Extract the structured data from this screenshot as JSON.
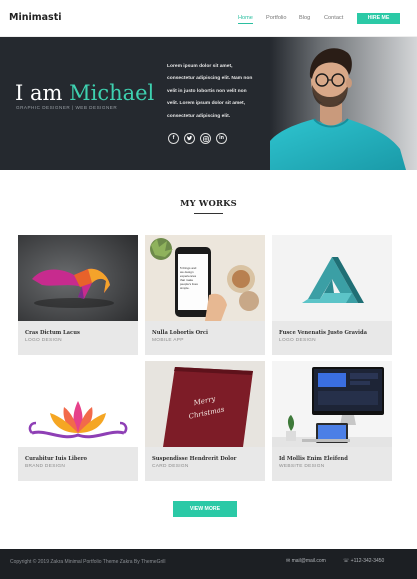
{
  "navbar": {
    "brand": "Minimasti",
    "links": [
      "Home",
      "Portfolio",
      "Blog",
      "Contact"
    ],
    "active_link": "Home",
    "hire_label": "HIRE ME"
  },
  "hero": {
    "greeting": "I am",
    "name": "Michael",
    "subtitle": "GRAPHIC DESIGNER | WEB DESIGNER",
    "text_lines": [
      "Lorem ipsum dolor sit amet,",
      "consectetur adipiscing elit. Nam non",
      "velit in justo lobortis non velit non",
      "velit. Lorem ipsum dolor sit amet,",
      "consectetur adipiscing elit."
    ],
    "social_icons": [
      "facebook-icon",
      "twitter-icon",
      "instagram-icon",
      "linkedin-icon"
    ]
  },
  "works": {
    "title": "MY WORKS",
    "items": [
      {
        "title": "Cras Dictum Lacus",
        "category": "LOGO DESIGN"
      },
      {
        "title": "Nulla Lobortis Orci",
        "category": "MOBILE APP"
      },
      {
        "title": "Fusce Venenatis Justo Gravida",
        "category": "LOGO DESIGN"
      },
      {
        "title": "Curabitur Iuis Libero",
        "category": "BRAND DESIGN"
      },
      {
        "title": "Suspendisse Hendrerit Dolor",
        "category": "CARD DESIGN"
      },
      {
        "title": "Id Mollis Enim Eleifend",
        "category": "WEBSITE DESIGN"
      }
    ],
    "view_more_label": "VIEW MORE",
    "card_texts": {
      "phone_screen": "5 things and we design experiences that make people's lives simple.",
      "card_script": "Merry Christmas"
    }
  },
  "footer": {
    "copyright": "Copyright © 2019 Zakra Minimal Portfolio Theme Zakra By ThemeGrill",
    "email": "mail@mail.com",
    "phone": "+112-342-3450"
  },
  "colors": {
    "accent": "#2bc9a6",
    "hero_bg": "#25292f",
    "footer_bg": "#1c1f23"
  }
}
